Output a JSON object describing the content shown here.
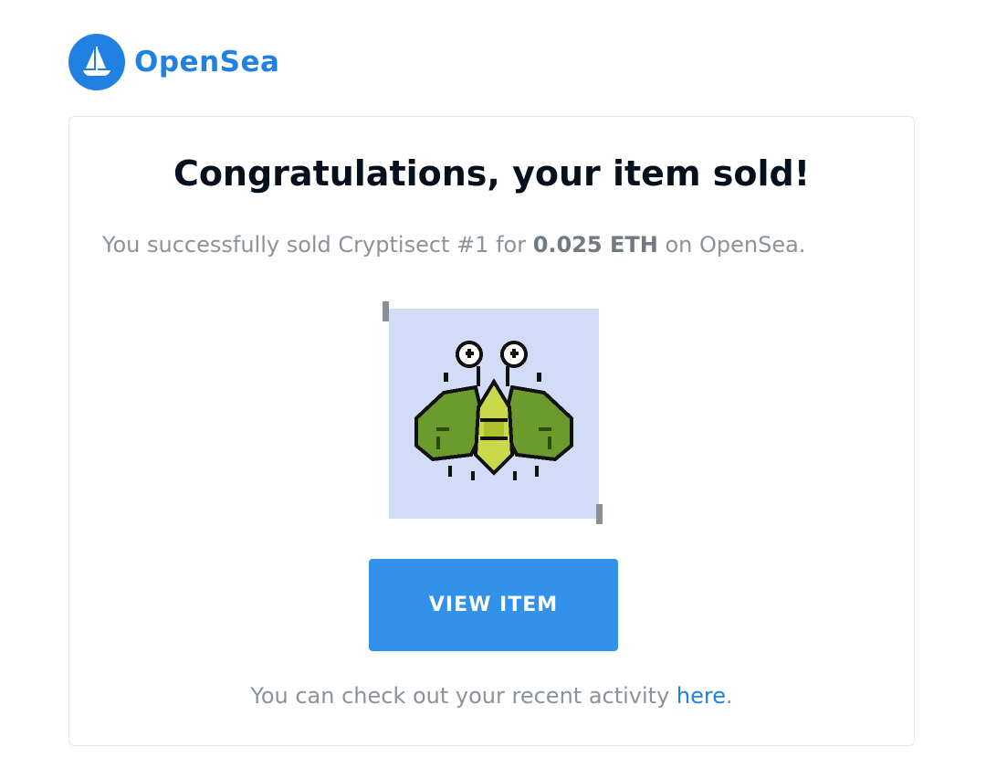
{
  "brand": {
    "name": "OpenSea",
    "color": "#2081e2",
    "logo_icon": "sailboat-icon"
  },
  "email": {
    "headline": "Congratulations, your item sold!",
    "message": {
      "prefix": "You successfully sold Cryptisect #1 for ",
      "price": "0.025 ETH",
      "suffix": " on OpenSea."
    },
    "item": {
      "image_icon": "pixel-insect-icon",
      "image_background": "#d3dcf6"
    },
    "button_label": "VIEW ITEM",
    "button_color": "#3291e9",
    "footer": {
      "prefix": "You can check out your recent activity ",
      "link_label": "here",
      "suffix": "."
    }
  }
}
